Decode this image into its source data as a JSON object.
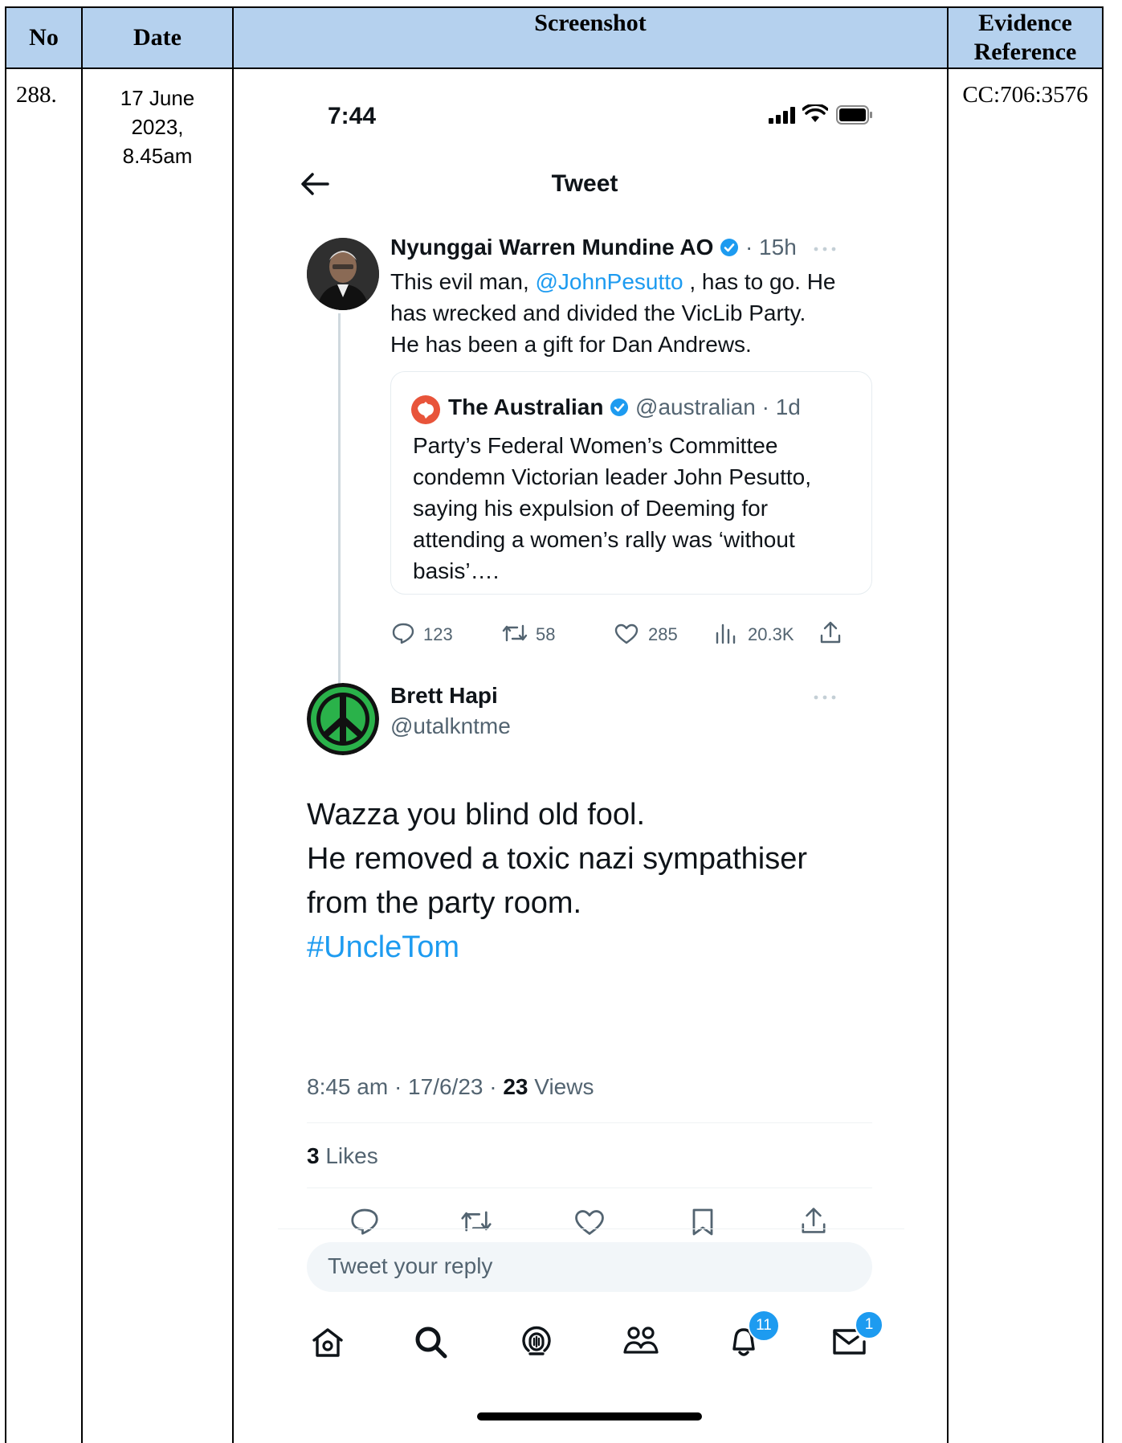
{
  "table": {
    "headers": {
      "no": "No",
      "date": "Date",
      "screenshot": "Screenshot",
      "evidence_line1": "Evidence",
      "evidence_line2": "Reference"
    },
    "row": {
      "no": "288.",
      "date_line1": "17 June",
      "date_line2": "2023,",
      "date_line3": "8.45am",
      "evidence": "CC:706:3576"
    }
  },
  "phone": {
    "status": {
      "time": "7:44"
    },
    "nav": {
      "title": "Tweet"
    },
    "parent_tweet": {
      "author": "Nyunggai Warren Mundine AO",
      "time": "· 15h",
      "text_before_mention": "This evil man, ",
      "mention": "@JohnPesutto",
      "text_after_mention": " , has to go. He",
      "line2": "has wrecked and divided the VicLib Party.",
      "line3": "He has been a gift for Dan Andrews.",
      "quote": {
        "author": "The Australian",
        "handle": "@australian · 1d",
        "line1": "Party’s Federal Women’s Committee",
        "line2": "condemn Victorian leader John Pesutto,",
        "line3": "saying his expulsion of Deeming for",
        "line4": "attending a women’s rally was ‘without",
        "line5": "basis’…."
      },
      "stats": {
        "replies": "123",
        "retweets": "58",
        "likes": "285",
        "views": "20.3K"
      }
    },
    "reply_tweet": {
      "author": "Brett Hapi",
      "handle": "@utalkntme",
      "line1": "Wazza you blind old fool.",
      "line2": "He removed a toxic nazi sympathiser",
      "line3": "from the party room.",
      "hashtag": "#UncleTom",
      "meta_time": "8:45 am · 17/6/23 · ",
      "meta_views_count": "23",
      "meta_views_label": " Views",
      "likes_count": "3",
      "likes_label": " Likes"
    },
    "reply_box": {
      "placeholder": "Tweet your reply"
    },
    "tab_bar": {
      "notifications_badge": "11",
      "messages_badge": "1"
    },
    "colors": {
      "accent": "#1d9bf0",
      "header_bg": "#b5d1ee",
      "australian_red": "#e8543a"
    }
  }
}
